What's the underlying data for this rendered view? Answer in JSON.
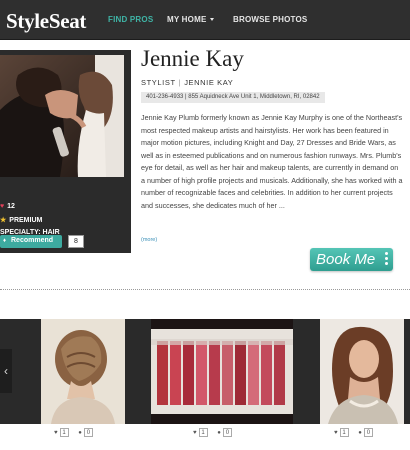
{
  "nav": {
    "logo": "StyleSeat",
    "items": [
      {
        "label": "FIND PROS",
        "active": true
      },
      {
        "label": "MY HOME",
        "dropdown": true
      },
      {
        "label": "BROWSE PHOTOS"
      }
    ]
  },
  "profile": {
    "name": "Jennie Kay",
    "role": "STYLIST",
    "business": "JENNIE KAY",
    "contact": "401-236-4933 | 855 Aquidneck Ave Unit 1, Middletown, RI, 02842",
    "bio": "Jennie Kay Plumb formerly known as Jennie Kay Murphy is one of the Northeast's most respected makeup artists and hairstylists. Her work has been featured in major motion pictures, including Knight and Day, 27 Dresses and Bride Wars, as well as in esteemed publications and on numerous fashion runways. Mrs. Plumb's eye for detail, as well as her hair and makeup talents, are currently in demand on a number of high profile projects and musicals. Additionally, she has worked with a number of recognizable faces and celebrities. In addition to her current projects and successes, she dedicates much of her ...",
    "more_label": "(more)",
    "book_label": "Book Me"
  },
  "card": {
    "recommend_label": "Recommend",
    "recommend_count": "8",
    "hearts": "12",
    "premium": "PREMIUM",
    "specialty": "SPECIALTY: HAIR"
  },
  "gallery": {
    "items": [
      {
        "likes": "1",
        "comments": "0"
      },
      {
        "likes": "1",
        "comments": "0"
      },
      {
        "likes": "1",
        "comments": "0"
      }
    ]
  },
  "colors": {
    "accent": "#3fb4a6",
    "nav_bg": "#2f2f2f",
    "card_bg": "#2b2b2b"
  }
}
